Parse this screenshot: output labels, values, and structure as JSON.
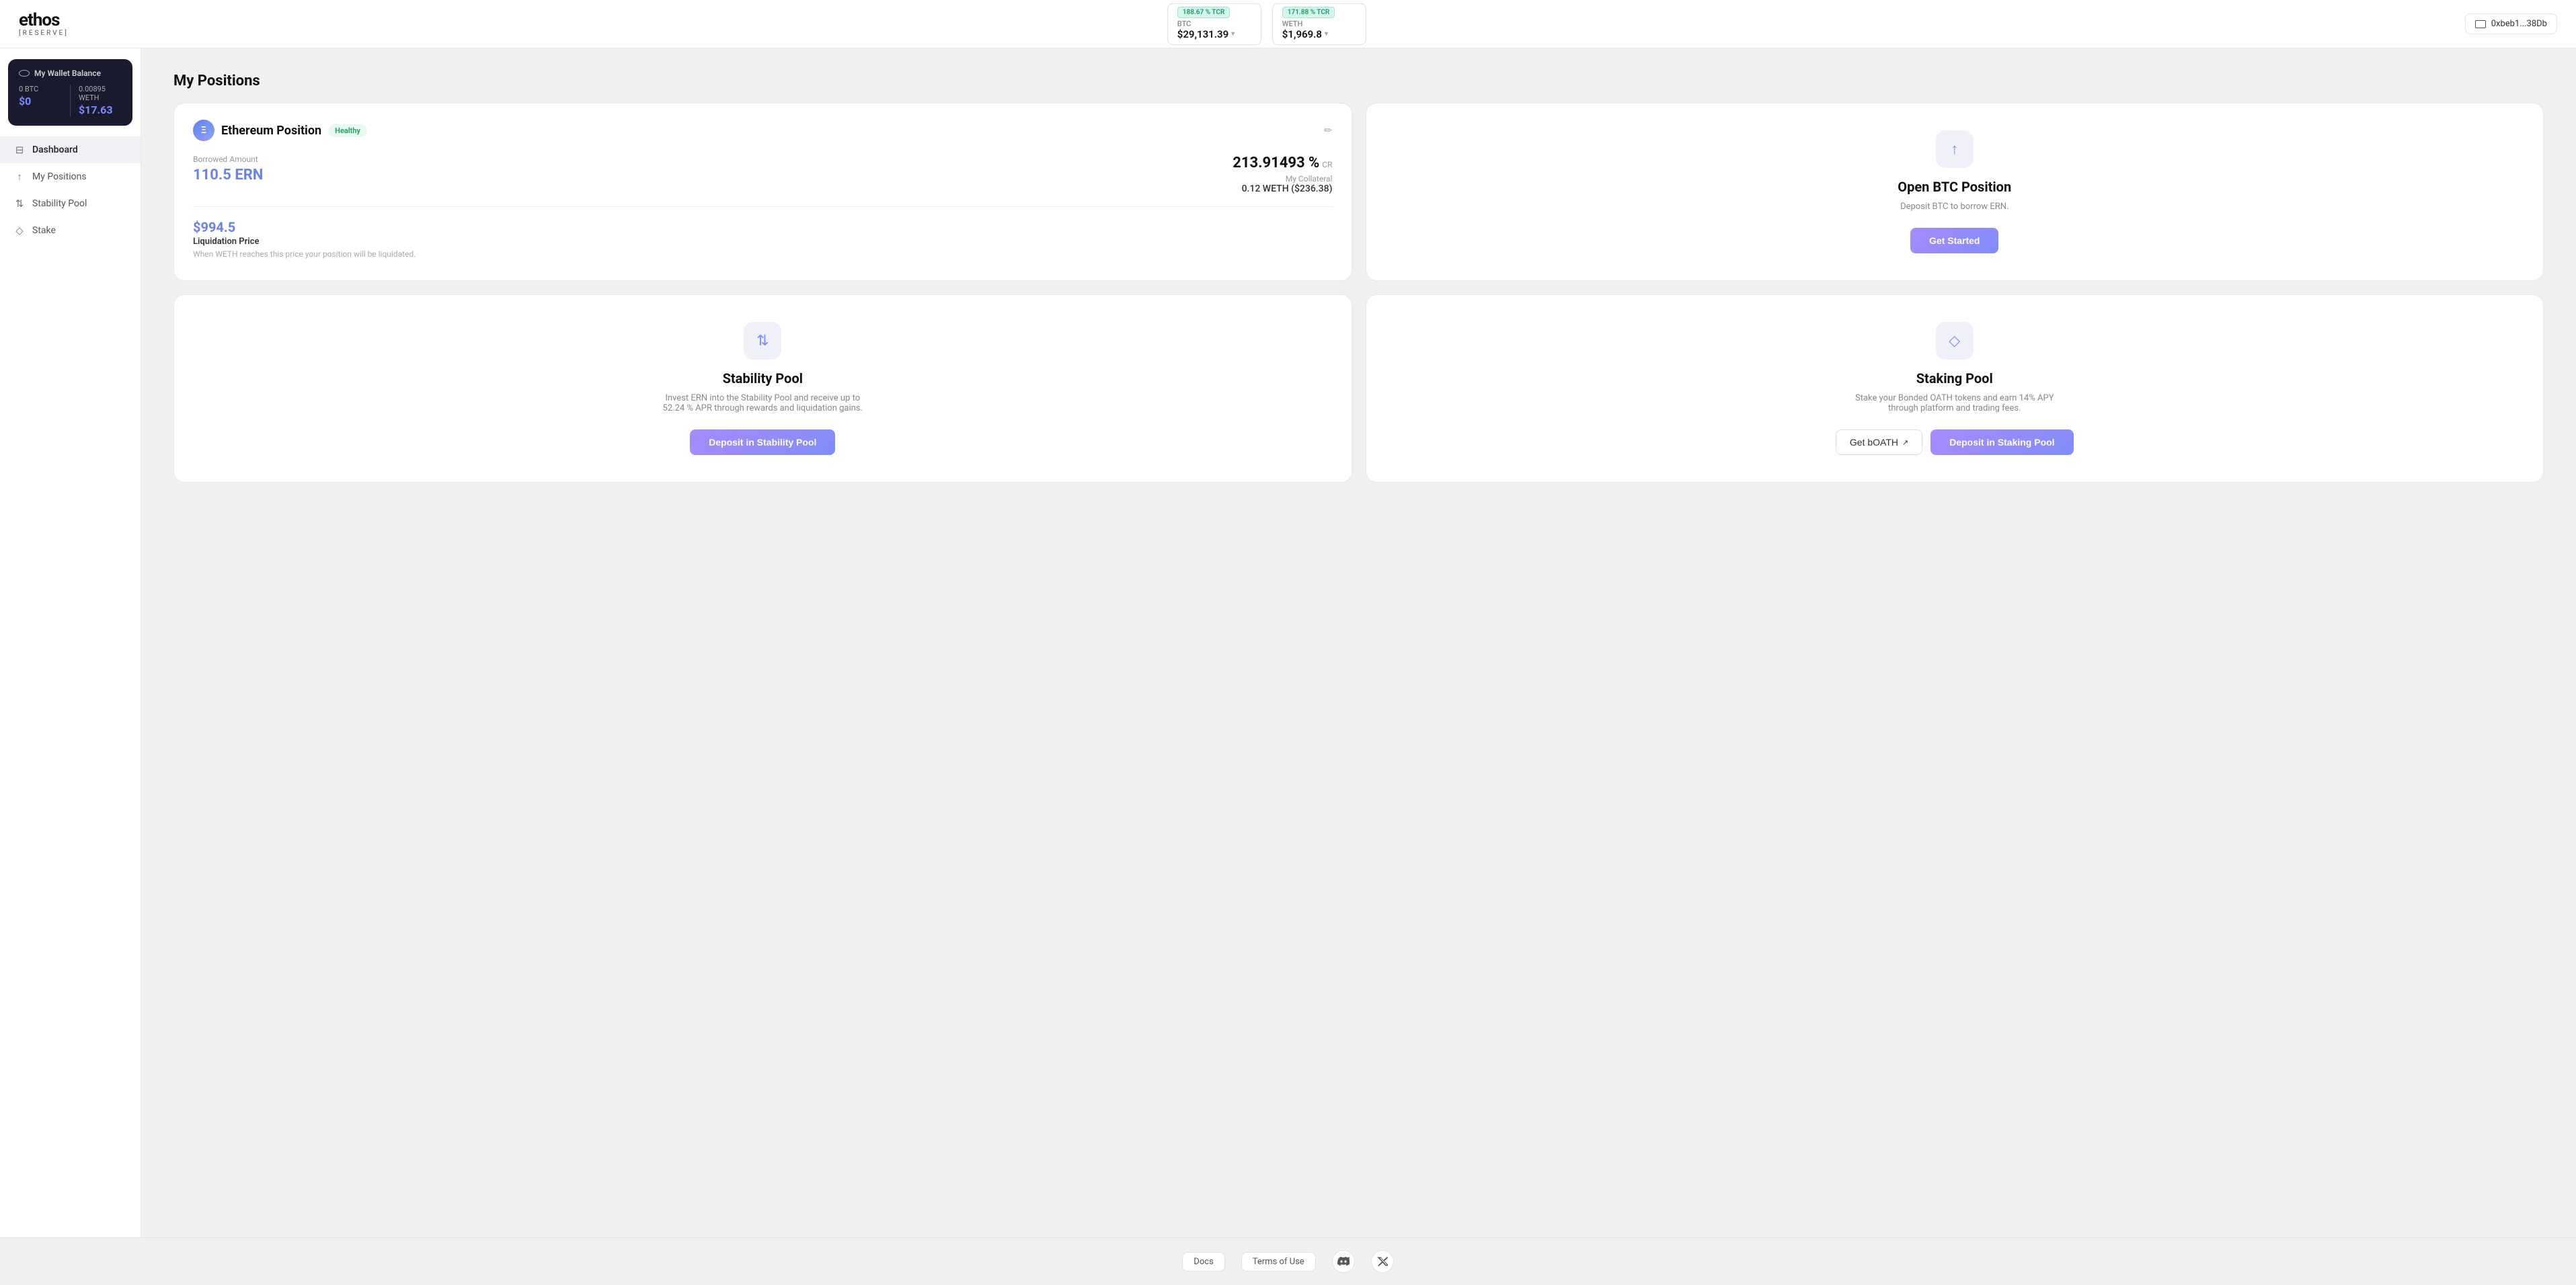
{
  "logo": {
    "title": "ethos",
    "subtitle": "[RESERVE]"
  },
  "nav": {
    "btc": {
      "tcr": "188.67 % TCR",
      "label": "BTC",
      "price": "$29,131.39"
    },
    "weth": {
      "tcr": "171.88 % TCR",
      "label": "WETH",
      "price": "$1,969.8"
    },
    "wallet": {
      "address": "0xbeb1...38Db"
    }
  },
  "sidebar": {
    "wallet_balance_label": "My Wallet Balance",
    "btc_amount": "0 BTC",
    "btc_usd": "$0",
    "weth_amount": "0.00895 WETH",
    "weth_usd": "$17.63",
    "nav_items": [
      {
        "id": "dashboard",
        "label": "Dashboard",
        "icon": "⊟"
      },
      {
        "id": "my-positions",
        "label": "My Positions",
        "icon": "↑"
      },
      {
        "id": "stability-pool",
        "label": "Stability Pool",
        "icon": "↕"
      },
      {
        "id": "stake",
        "label": "Stake",
        "icon": "◇"
      }
    ]
  },
  "main": {
    "section_title": "My Positions",
    "ethereum_position": {
      "title": "Ethereum Position",
      "status": "Healthy",
      "borrowed_label": "Borrowed Amount",
      "borrowed_amount": "110.5 ERN",
      "cr_value": "213.91493 %",
      "cr_label": "CR",
      "collateral_label": "My Collateral",
      "collateral_value": "0.12 WETH ($236.38)",
      "liquidation_price": "$994.5",
      "liquidation_label": "Liquidation Price",
      "liquidation_desc": "When WETH reaches this price your position will be liquidated."
    },
    "open_btc": {
      "title": "Open BTC Position",
      "desc": "Deposit BTC to borrow ERN.",
      "button_label": "Get Started"
    },
    "stability_pool": {
      "title": "Stability Pool",
      "desc": "Invest ERN into the Stability Pool and receive up to 52.24 % APR through rewards and liquidation gains.",
      "button_label": "Deposit in Stability Pool"
    },
    "staking_pool": {
      "title": "Staking Pool",
      "desc": "Stake your Bonded OATH tokens and earn 14% APY through platform and trading fees.",
      "button_get_boath": "Get bOATH",
      "button_deposit": "Deposit in Staking Pool"
    }
  },
  "footer": {
    "docs_label": "Docs",
    "terms_label": "Terms of Use",
    "discord_icon": "discord",
    "twitter_icon": "twitter"
  }
}
